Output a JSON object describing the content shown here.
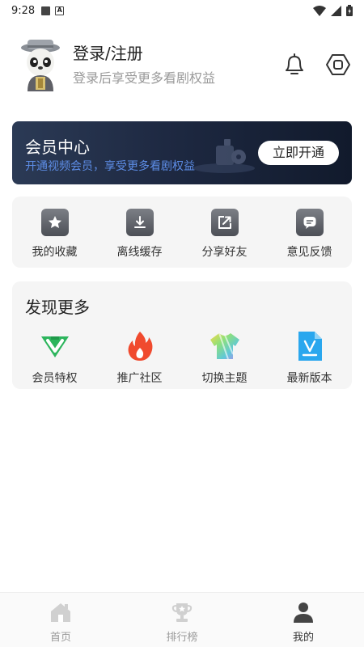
{
  "status_bar": {
    "time": "9:28"
  },
  "profile": {
    "title": "登录/注册",
    "subtitle": "登录后享受更多看剧权益"
  },
  "vip_card": {
    "title": "会员中心",
    "subtitle": "开通视频会员，享受更多看剧权益",
    "button_label": "立即开通"
  },
  "quick_actions": [
    {
      "label": "我的收藏",
      "icon": "star-icon"
    },
    {
      "label": "离线缓存",
      "icon": "download-icon"
    },
    {
      "label": "分享好友",
      "icon": "share-icon"
    },
    {
      "label": "意见反馈",
      "icon": "feedback-icon"
    }
  ],
  "discover": {
    "title": "发现更多",
    "items": [
      {
        "label": "会员特权",
        "icon": "vip-privilege-icon",
        "color": "#2db55d"
      },
      {
        "label": "推广社区",
        "icon": "flame-icon",
        "color": "#f04a2e"
      },
      {
        "label": "切换主题",
        "icon": "theme-shirt-icon",
        "color": "#7ad9a6"
      },
      {
        "label": "最新版本",
        "icon": "version-file-icon",
        "color": "#2aa7ee"
      }
    ]
  },
  "bottom_nav": [
    {
      "label": "首页",
      "icon": "home-icon",
      "active": false
    },
    {
      "label": "排行榜",
      "icon": "trophy-icon",
      "active": false
    },
    {
      "label": "我的",
      "icon": "person-icon",
      "active": true
    }
  ]
}
